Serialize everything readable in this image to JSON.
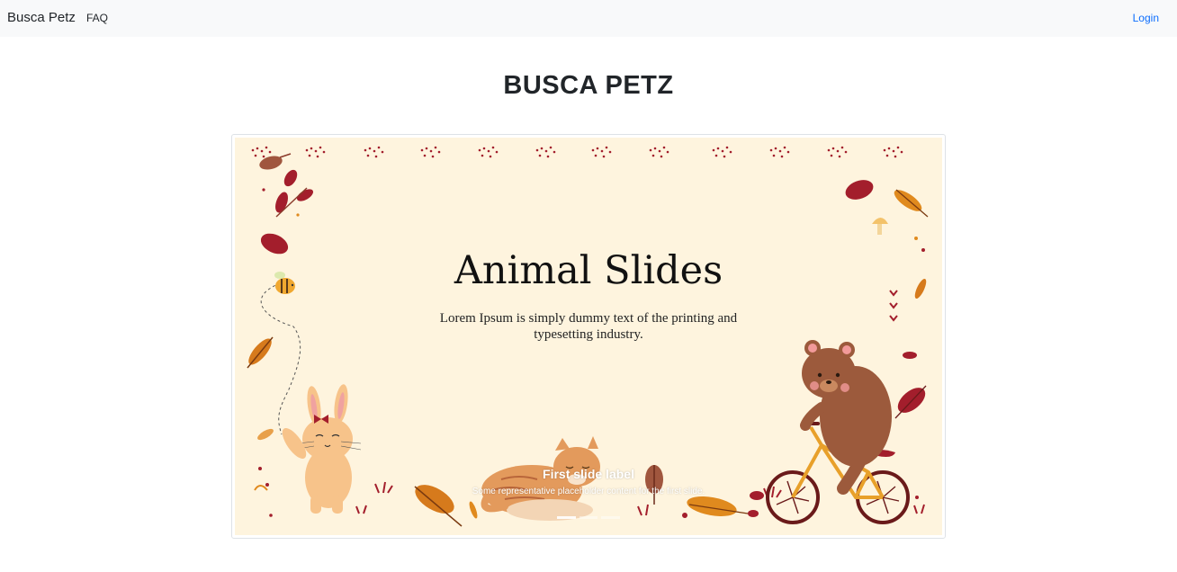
{
  "navbar": {
    "brand": "Busca Petz",
    "links": [
      {
        "label": "FAQ"
      }
    ],
    "login_label": "Login"
  },
  "page": {
    "title": "BUSCA PETZ"
  },
  "carousel": {
    "slide": {
      "title": "Animal Slides",
      "text": "Lorem Ipsum is simply dummy text of the printing and typesetting industry.",
      "caption_title": "First slide label",
      "caption_text": "Some representative placeholder content for the first slide."
    }
  },
  "colors": {
    "background": "#fef4de",
    "navbar_bg": "#f8f9fa",
    "link_blue": "#0d6efd",
    "leaf_red": "#a31e2c",
    "leaf_orange": "#e08a1e",
    "bear_brown": "#9c5a3c",
    "cat_orange": "#e39a5c",
    "bunny_peach": "#f7c38a"
  }
}
